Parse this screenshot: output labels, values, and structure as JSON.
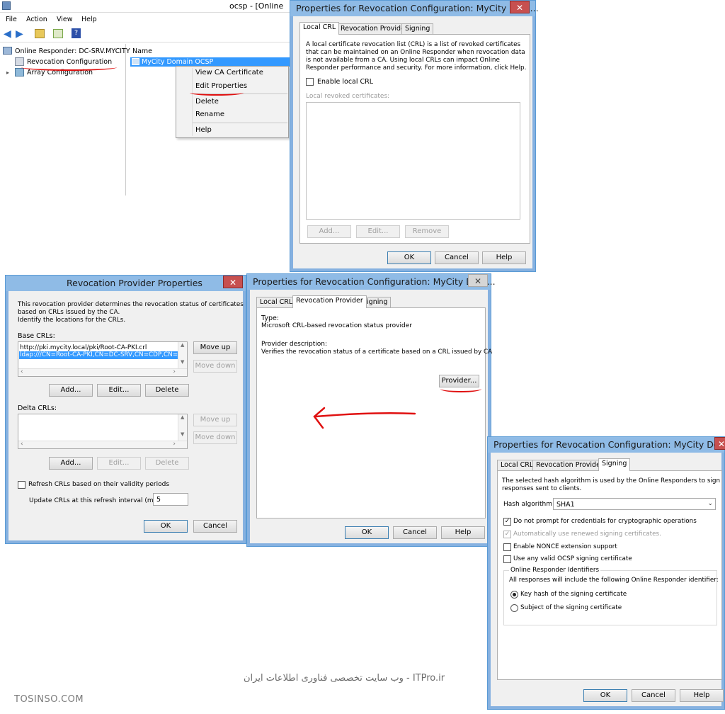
{
  "mmc": {
    "title": "ocsp - [Online",
    "menu": [
      "File",
      "Action",
      "View",
      "Help"
    ],
    "tree": {
      "root": "Online Responder: DC-SRV.MYCITY",
      "items": [
        "Revocation Configuration",
        "Array Configuration"
      ]
    },
    "list_header": "Name",
    "list_item": "MyCity Domain OCSP",
    "context_menu": [
      "View CA Certificate",
      "Edit Properties",
      "Delete",
      "Rename",
      "Help"
    ]
  },
  "dialog_local_crl": {
    "title": "Properties for Revocation Configuration: MyCity Dom...",
    "tabs": [
      "Local CRL",
      "Revocation Provider",
      "Signing"
    ],
    "desc": [
      "A local certificate revocation list (CRL) is a list of revoked certificates",
      "that can be maintained on an Online Responder when revocation data",
      "is not available from a CA. Using local CRLs can impact Online",
      "Responder performance and security. For more information, click Help."
    ],
    "enable_label": "Enable local CRL",
    "list_label": "Local revoked certificates:",
    "buttons": [
      "Add...",
      "Edit...",
      "Remove"
    ],
    "footer": [
      "OK",
      "Cancel",
      "Help"
    ]
  },
  "dialog_provider_props": {
    "title": "Revocation Provider Properties",
    "desc": [
      "This revocation provider determines the revocation status of certificates",
      "based on CRLs issued by the CA.",
      "Identify the locations for the CRLs."
    ],
    "base_label": "Base CRLs:",
    "base_items": [
      "http://pki.mycity.local/pki/Root-CA-PKI.crl",
      "ldap:///CN=Root-CA-PKI,CN=DC-SRV,CN=CDP,CN=Pu"
    ],
    "move_up": "Move up",
    "move_down": "Move down",
    "add": "Add...",
    "edit": "Edit...",
    "delete": "Delete",
    "delta_label": "Delta CRLs:",
    "refresh_label": "Refresh CRLs based on their validity periods",
    "interval_label": "Update CRLs at this refresh interval (min):",
    "interval_value": "5",
    "ok": "OK",
    "cancel": "Cancel"
  },
  "dialog_rev_provider": {
    "title": "Properties for Revocation Configuration: MyCity Dom...",
    "tabs": [
      "Local CRL",
      "Revocation Provider",
      "Signing"
    ],
    "type_label": "Type:",
    "type_value": "Microsoft CRL-based revocation status provider",
    "desc_label": "Provider description:",
    "desc_value": "Verifies the revocation status of a certificate based on a CRL issued by CA",
    "provider_button": "Provider...",
    "footer": [
      "OK",
      "Cancel",
      "Help"
    ]
  },
  "dialog_signing": {
    "title": "Properties for Revocation Configuration: MyCity Dom...",
    "tabs": [
      "Local CRL",
      "Revocation Provider",
      "Signing"
    ],
    "desc": [
      "The selected hash algorithm is used by the Online Responders to sign",
      "responses sent to clients."
    ],
    "hash_label": "Hash algorithm:",
    "hash_value": "SHA1",
    "options": [
      "Do not prompt for credentials for cryptographic operations",
      "Automatically use renewed signing certificates.",
      "Enable NONCE extension support",
      "Use any valid OCSP signing certificate"
    ],
    "group_title": "Online Responder Identifiers",
    "group_desc": "All responses will include the following Online Responder identifier:",
    "radios": [
      "Key hash of the signing certificate",
      "Subject of the signing certificate"
    ],
    "footer": [
      "OK",
      "Cancel",
      "Help"
    ]
  },
  "watermark_persian": "ITPro.ir - وب سایت تخصصی فناوری اطلاعات ایران",
  "watermark_site": "TOSINSO.COM",
  "colors": {
    "selection": "#3399ff",
    "annotation": "#e01010",
    "titlebar": "#8fbbe6",
    "close": "#c75050"
  }
}
